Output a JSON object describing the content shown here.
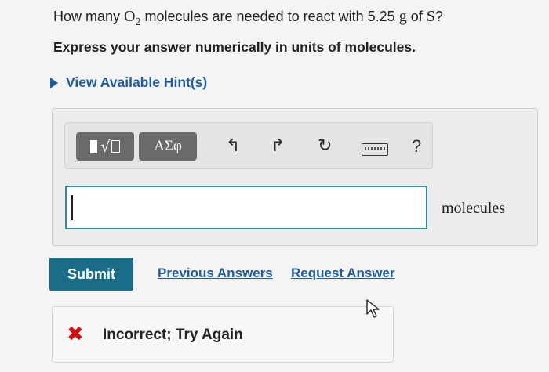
{
  "question": {
    "part1": "How many ",
    "species_main": "O",
    "species_sub": "2",
    "part2": " molecules are needed to react with 5.25 ",
    "unit_g": "g",
    "part3": " of ",
    "element": "S",
    "part4": "?"
  },
  "instruction": "Express your answer numerically in units of molecules.",
  "hint_link": "View Available Hint(s)",
  "toolbar": {
    "templates_icon": "radical-template-icon",
    "symbols_label": "ΑΣφ",
    "undo_icon": "undo-icon",
    "redo_icon": "redo-icon",
    "reset_icon": "reset-icon",
    "keyboard_icon": "keyboard-icon",
    "help_label": "?"
  },
  "answer": {
    "value": "",
    "units": "molecules"
  },
  "actions": {
    "submit_label": "Submit",
    "previous_answers_label": "Previous Answers",
    "request_answer_label": "Request Answer"
  },
  "feedback": {
    "status_icon": "x-mark-icon",
    "message": "Incorrect; Try Again"
  },
  "colors": {
    "link": "#1f5c99",
    "submit_bg": "#1a6c89",
    "input_border": "#2e8ba3",
    "error": "#cc1111"
  }
}
